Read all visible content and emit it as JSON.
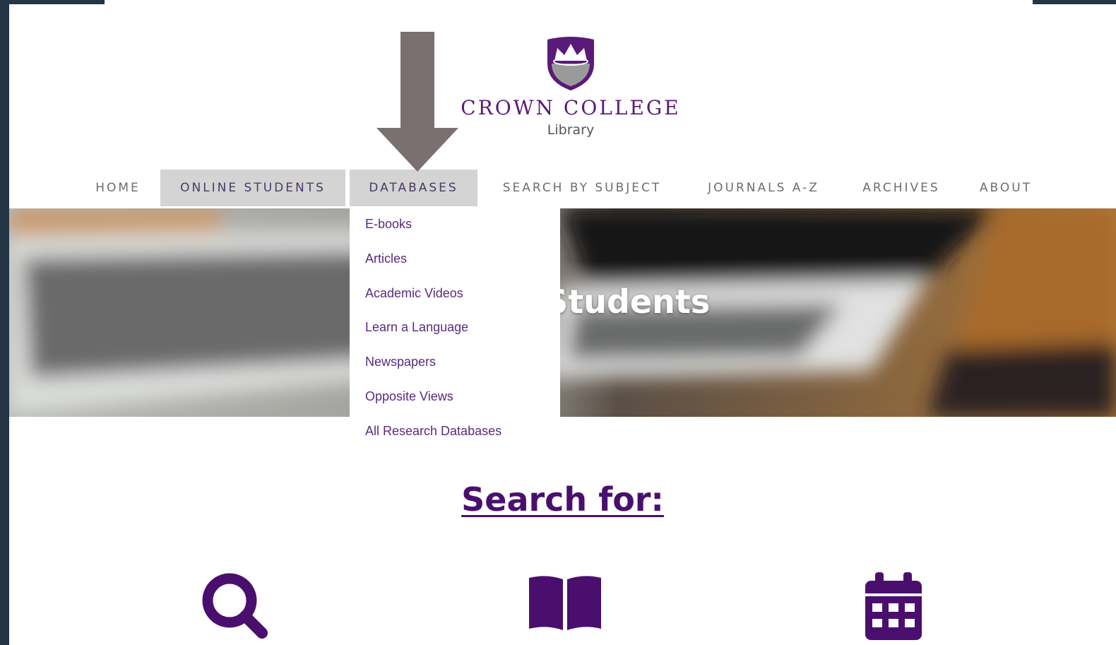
{
  "logo": {
    "title": "CROWN COLLEGE",
    "subtitle": "Library"
  },
  "nav": {
    "items": [
      {
        "label": "HOME"
      },
      {
        "label": "ONLINE STUDENTS"
      },
      {
        "label": "DATABASES"
      },
      {
        "label": "SEARCH BY SUBJECT"
      },
      {
        "label": "JOURNALS A-Z"
      },
      {
        "label": "ARCHIVES"
      },
      {
        "label": "ABOUT"
      }
    ]
  },
  "dropdown": {
    "items": [
      {
        "label": "E-books"
      },
      {
        "label": "Articles"
      },
      {
        "label": "Academic Videos"
      },
      {
        "label": "Learn a Language"
      },
      {
        "label": "Newspapers"
      },
      {
        "label": "Opposite Views"
      },
      {
        "label": "All Research Databases"
      }
    ]
  },
  "hero": {
    "title": "Online Students"
  },
  "search": {
    "heading": "Search for:"
  },
  "icons": [
    "search-icon",
    "book-icon",
    "calendar-icon"
  ],
  "colors": {
    "brand_purple": "#4a0f6e",
    "nav_active_bg": "#d4d4d4",
    "arrow_gray": "#7a7072"
  }
}
